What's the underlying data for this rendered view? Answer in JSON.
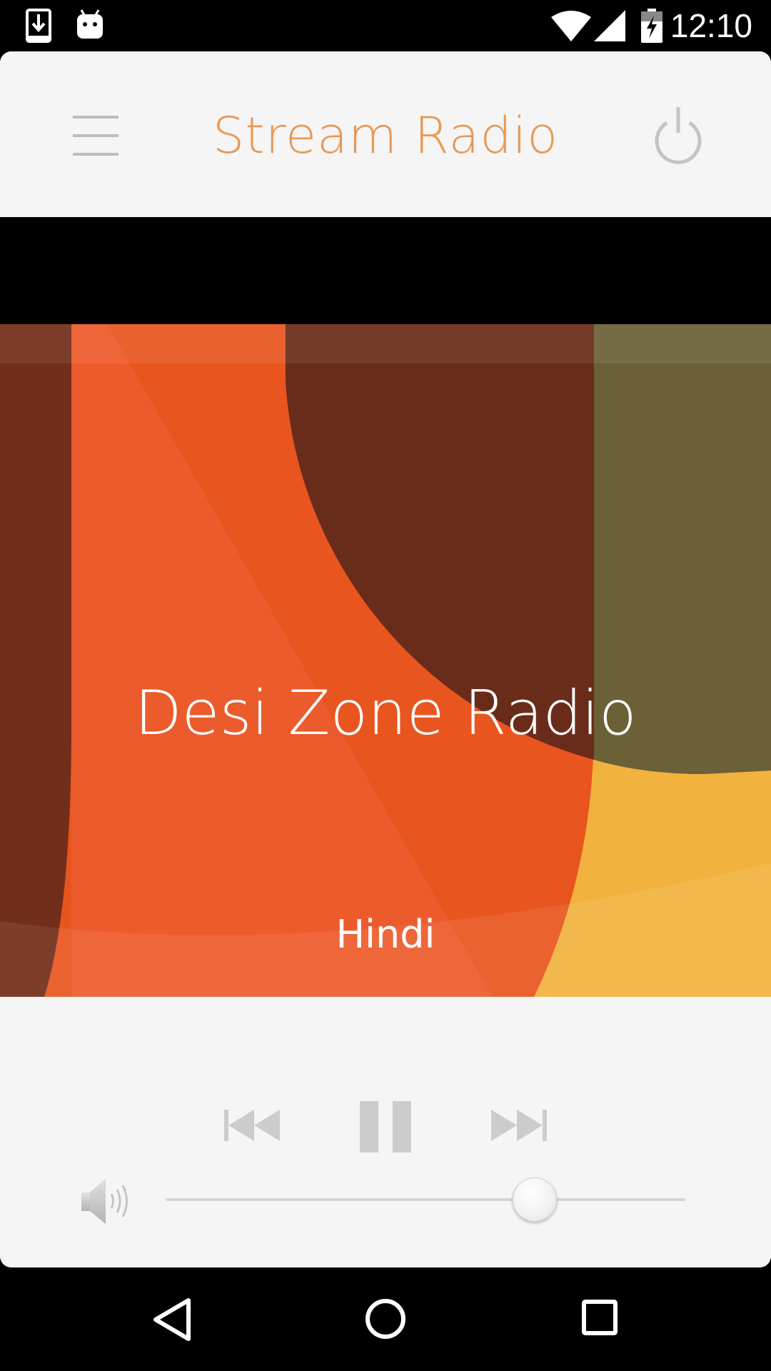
{
  "status_bar": {
    "time": "12:10",
    "icons": [
      "download-notification-icon",
      "android-debug-icon",
      "wifi-icon",
      "cell-signal-icon",
      "battery-charging-icon"
    ]
  },
  "header": {
    "title": "Stream Radio",
    "menu_icon": "hamburger-menu-icon",
    "power_icon": "power-icon",
    "title_color": "#e89955"
  },
  "station": {
    "name": "Desi Zone Radio",
    "genre": "Hindi"
  },
  "controls": {
    "previous_icon": "skip-previous-icon",
    "pause_icon": "pause-icon",
    "next_icon": "skip-next-icon",
    "volume_icon": "speaker-volume-icon",
    "volume_level": 0.71
  },
  "nav_bar": {
    "icons": [
      "back-icon",
      "home-icon",
      "recents-icon"
    ]
  },
  "colors": {
    "accent": "#e89955",
    "artwork_orange": "#e8551f",
    "artwork_brown": "#6a2c1a",
    "artwork_olive": "#6b6036",
    "artwork_yellow": "#f2b23e",
    "control_gray": "#cccccc"
  }
}
